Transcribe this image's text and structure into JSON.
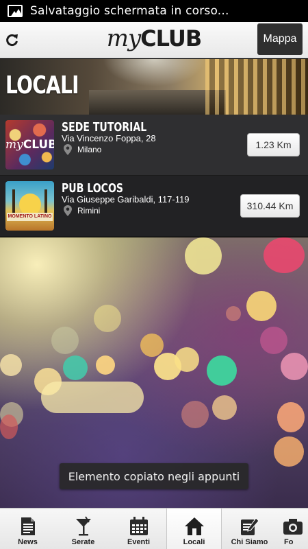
{
  "status_bar": {
    "notification_icon": "image-icon",
    "text": "Salvataggio schermata in corso..."
  },
  "header": {
    "refresh_icon": "refresh-icon",
    "logo_my": "my",
    "logo_club": "CLUB",
    "map_button": "Mappa"
  },
  "banner": {
    "title": "LOCALI"
  },
  "venues": [
    {
      "name": "SEDE TUTORIAL",
      "address": "Via Vincenzo Foppa, 28",
      "city": "Milano",
      "distance": "1.23 Km",
      "thumb_my": "my",
      "thumb_club": "CLUB"
    },
    {
      "name": "PUB LOCOS",
      "address": "Via Giuseppe Garibaldi, 117-119",
      "city": "Rimini",
      "distance": "310.44 Km",
      "thumb_text": "MOMENTO LATINO"
    }
  ],
  "toast": {
    "text": "Elemento copiato negli appunti"
  },
  "bottom_nav": {
    "items": [
      {
        "label": "News",
        "icon": "document-icon"
      },
      {
        "label": "Serate",
        "icon": "cocktail-icon"
      },
      {
        "label": "Eventi",
        "icon": "calendar-icon"
      },
      {
        "label": "Locali",
        "icon": "home-icon",
        "active": true
      },
      {
        "label": "Chi Siamo",
        "icon": "notepad-pencil-icon"
      },
      {
        "label": "Fo",
        "icon": "camera-icon"
      }
    ]
  },
  "colors": {
    "header_bg": "#f2f2f2",
    "list_row_odd": "#2f2f31",
    "list_row_even": "#222224",
    "map_button_bg": "#2f2f2f"
  }
}
